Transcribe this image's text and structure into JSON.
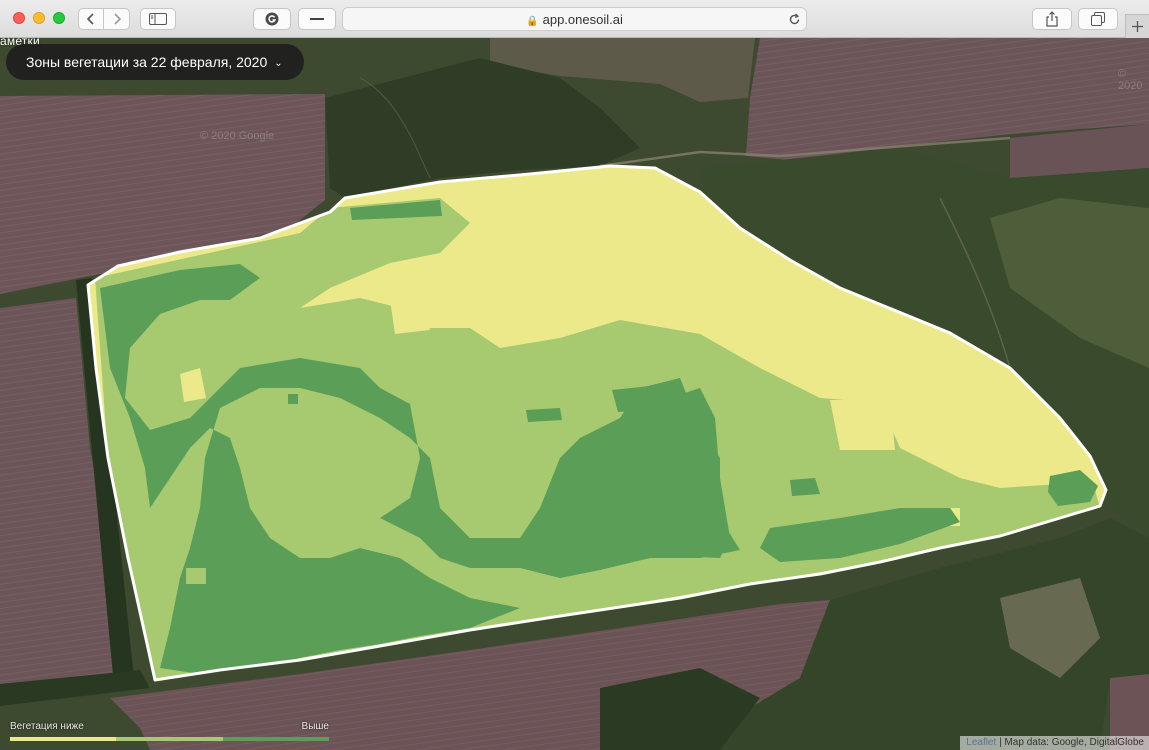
{
  "browser": {
    "url": "app.onesoil.ai",
    "buttons": {
      "back": "back-icon",
      "forward": "forward-icon",
      "sidebar": "sidebar-icon",
      "extension": "grammarly-icon",
      "minus": "minus-icon",
      "reload": "reload-icon",
      "share": "share-icon",
      "tabs": "tabs-icon",
      "new_tab": "plus-icon"
    },
    "traffic_colors": {
      "close": "#ff5f57",
      "minimize": "#febc2e",
      "zoom": "#28c840"
    }
  },
  "map": {
    "partial_label": "аметки",
    "date_selector": "Зоны вегетации за 22 февраля, 2020",
    "watermarks": [
      "© 2020 Google",
      "© 2020"
    ],
    "legend": {
      "low_label": "Вегетация ниже",
      "high_label": "Выше",
      "colors": [
        "#ebe98a",
        "#a7c96f",
        "#5a9e58"
      ]
    },
    "attribution": {
      "link": "Leaflet",
      "separator": " | ",
      "text": "Map data: Google, DigitalGlobe"
    },
    "zone_colors": {
      "low": "#ebe98a",
      "medium": "#a7c96f",
      "high": "#5a9e58",
      "boundary": "#ffffff"
    }
  }
}
